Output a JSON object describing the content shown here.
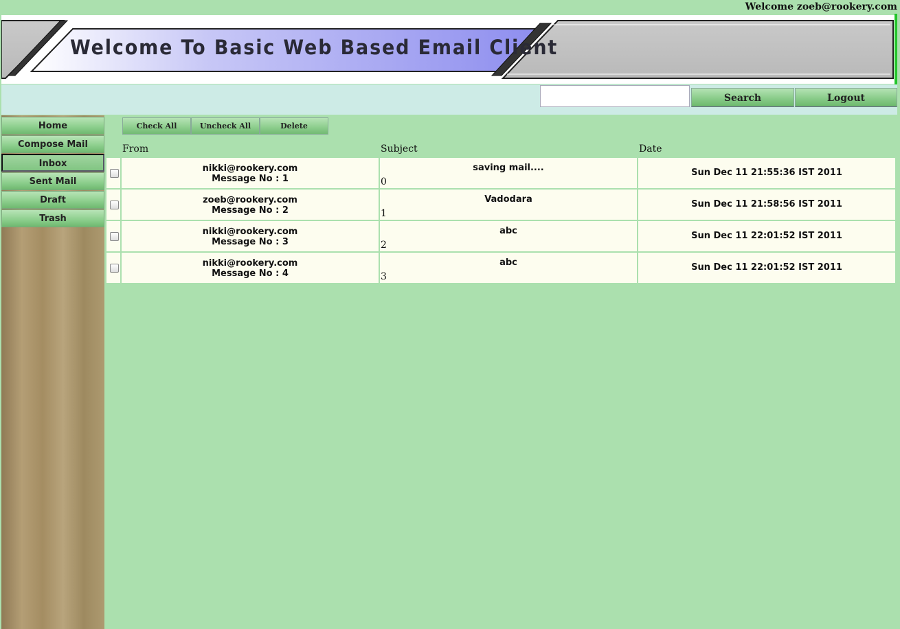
{
  "header": {
    "welcome_text": "Welcome zoeb@rookery.com",
    "banner_title": "Welcome To Basic Web Based Email Client"
  },
  "search": {
    "placeholder": "",
    "value": "",
    "search_label": "Search",
    "logout_label": "Logout"
  },
  "sidebar": {
    "items": [
      {
        "label": "Home"
      },
      {
        "label": "Compose Mail"
      },
      {
        "label": "Inbox",
        "active": true
      },
      {
        "label": "Sent Mail"
      },
      {
        "label": "Draft"
      },
      {
        "label": "Trash"
      }
    ]
  },
  "toolbar": {
    "check_all": "Check All",
    "uncheck_all": "Uncheck All",
    "delete": "Delete"
  },
  "table": {
    "columns": [
      "From",
      "Subject",
      "Date"
    ],
    "rows": [
      {
        "checked": false,
        "from": "nikki@rookery.com",
        "message_no": "Message No : 1",
        "subject": "saving mail....",
        "index": "0",
        "date": "Sun Dec 11 21:55:36 IST 2011"
      },
      {
        "checked": false,
        "from": "zoeb@rookery.com",
        "message_no": "Message No : 2",
        "subject": "Vadodara",
        "index": "1",
        "date": "Sun Dec 11 21:58:56 IST 2011"
      },
      {
        "checked": false,
        "from": "nikki@rookery.com",
        "message_no": "Message No : 3",
        "subject": "abc",
        "index": "2",
        "date": "Sun Dec 11 22:01:52 IST 2011"
      },
      {
        "checked": false,
        "from": "nikki@rookery.com",
        "message_no": "Message No : 4",
        "subject": "abc",
        "index": "3",
        "date": "Sun Dec 11 22:01:52 IST 2011"
      }
    ]
  },
  "colors": {
    "page_bg": "#abe0ae",
    "search_bar_bg": "#cdebe6",
    "row_bg": "#fdfdef",
    "accent_line": "#22c52a"
  }
}
